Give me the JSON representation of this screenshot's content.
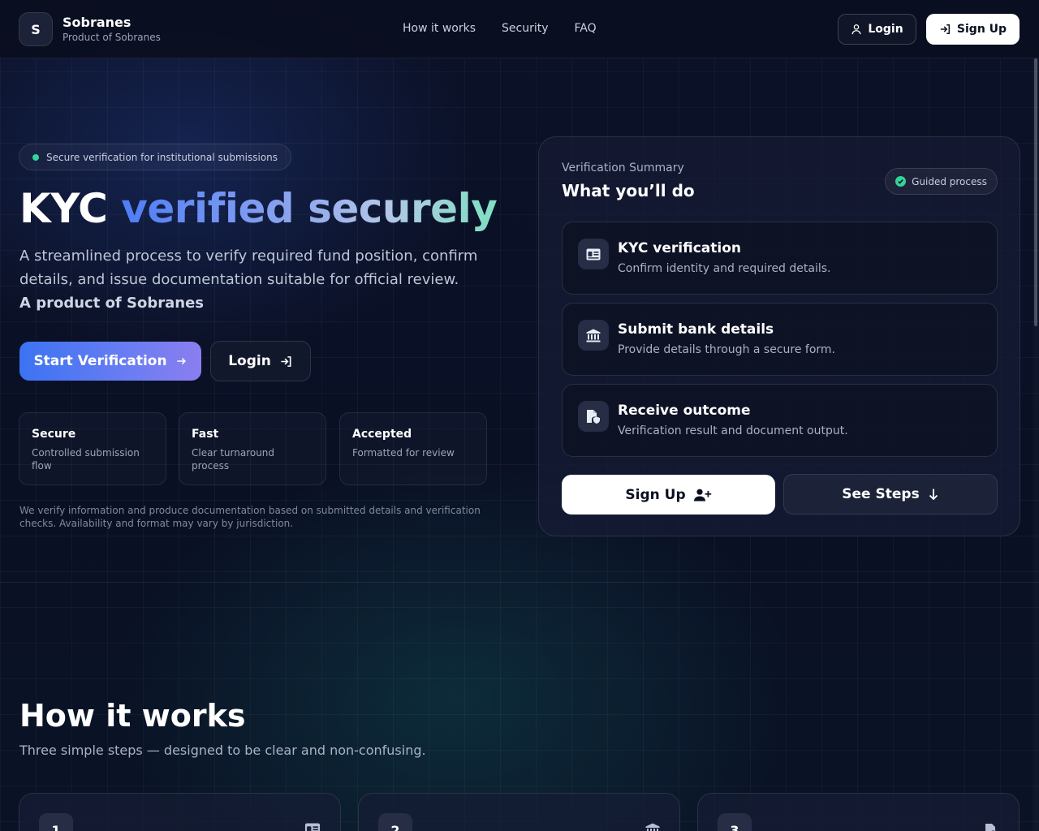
{
  "brand": {
    "initial": "S",
    "name": "Sobranes",
    "subtitle": "Product of Sobranes"
  },
  "nav": [
    "How it works",
    "Security",
    "FAQ"
  ],
  "header_buttons": {
    "login": "Login",
    "signup": "Sign Up"
  },
  "hero": {
    "badge": "Secure verification for institutional submissions",
    "title_plain": "KYC",
    "title_gradient": "verified securely",
    "description": "A streamlined process to verify required fund position, confirm details, and issue documentation suitable for official review.",
    "product_line": "A product of Sobranes",
    "start_button": "Start Verification",
    "login_button": "Login",
    "features": [
      {
        "title": "Secure",
        "desc": "Controlled submission flow"
      },
      {
        "title": "Fast",
        "desc": "Clear turnaround process"
      },
      {
        "title": "Accepted",
        "desc": "Formatted for review"
      }
    ],
    "disclaimer": "We verify information and produce documentation based on submitted details and verification checks. Availability and format may vary by jurisdiction."
  },
  "summary": {
    "label": "Verification Summary",
    "title": "What you’ll do",
    "badge": "Guided process",
    "steps": [
      {
        "title": "KYC verification",
        "desc": "Confirm identity and required details.",
        "icon": "id-card-icon"
      },
      {
        "title": "Submit bank details",
        "desc": "Provide details through a secure form.",
        "icon": "bank-icon"
      },
      {
        "title": "Receive outcome",
        "desc": "Verification result and document output.",
        "icon": "document-shield-icon"
      }
    ],
    "signup_button": "Sign Up",
    "steps_button": "See Steps"
  },
  "how_it_works": {
    "title": "How it works",
    "subtitle": "Three simple steps — designed to be clear and non-confusing.",
    "cards": [
      {
        "number": "1",
        "icon": "id-card-icon"
      },
      {
        "number": "2",
        "icon": "bank-icon"
      },
      {
        "number": "3",
        "icon": "document-shield-icon"
      }
    ]
  },
  "colors": {
    "accent_blue": "#3b73f3",
    "accent_green": "#34d399",
    "background": "#0a0f22"
  }
}
